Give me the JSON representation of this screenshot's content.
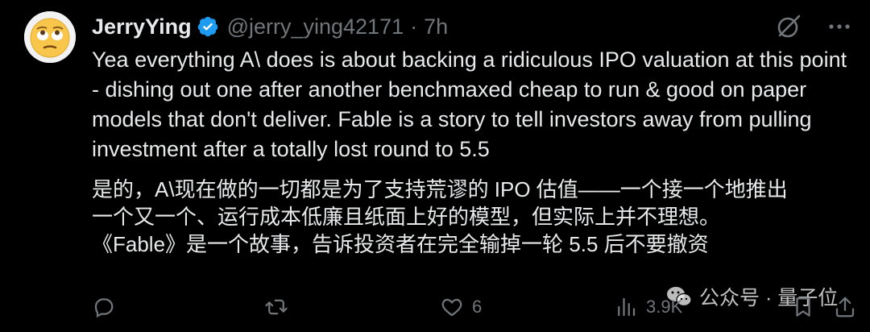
{
  "tweet": {
    "display_name": "JerryYing",
    "handle": "@jerry_ying42171",
    "separator": "·",
    "time": "7h",
    "text_en": "Yea everything A\\ does is about backing a ridiculous IPO valuation at this point - dishing out one after another benchmaxed cheap to run & good on paper models that don't deliver. Fable is a story to tell investors away from pulling investment after a totally lost round to 5.5",
    "text_zh_lines": [
      "是的，A\\现在做的一切都是为了支持荒谬的 IPO 估值——一个接一个地推出",
      "一个又一个、运行成本低廉且纸面上好的模型，但实际上并不理想。",
      "《Fable》是一个故事，告诉投资者在完全输掉一轮 5.5 后不要撤资"
    ]
  },
  "actions": {
    "reply_icon": "reply-icon",
    "retweet_icon": "retweet-icon",
    "like_icon": "heart-icon",
    "like_count": "6",
    "views_icon": "views-icon",
    "views_count": "3.9K",
    "bookmark_icon": "bookmark-icon",
    "share_icon": "share-icon"
  },
  "watermark": {
    "text": "公众号 · 量子位"
  },
  "colors": {
    "background": "#000000",
    "text": "#e7e9ea",
    "muted": "#71767b",
    "verified": "#1d9bf0"
  }
}
